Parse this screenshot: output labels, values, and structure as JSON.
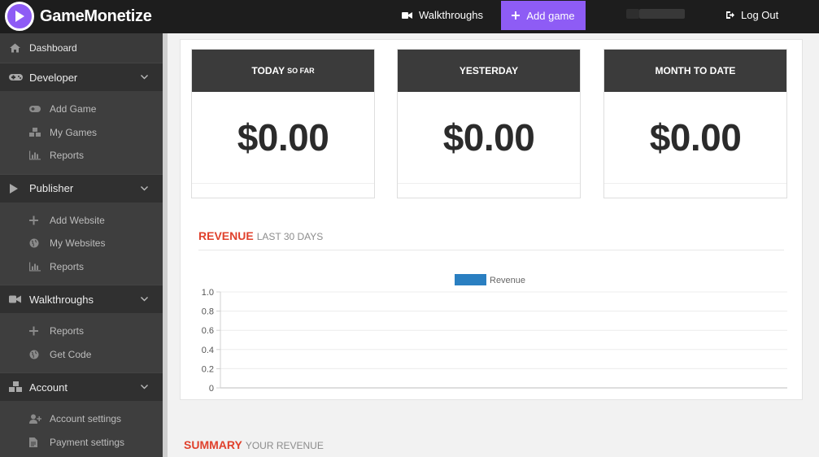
{
  "topbar": {
    "brand": "GameMonetize",
    "walkthroughs_label": "Walkthroughs",
    "add_game_label": "Add game",
    "logout_label": "Log Out"
  },
  "sidebar": {
    "dashboard": "Dashboard",
    "sections": [
      {
        "label": "Developer",
        "icon": "gamepad-icon",
        "items": [
          {
            "label": "Add Game",
            "icon": "gamepad-icon"
          },
          {
            "label": "My Games",
            "icon": "cubes-icon"
          },
          {
            "label": "Reports",
            "icon": "bar-chart-icon"
          }
        ]
      },
      {
        "label": "Publisher",
        "icon": "play-icon",
        "items": [
          {
            "label": "Add Website",
            "icon": "plus-icon"
          },
          {
            "label": "My Websites",
            "icon": "globe-icon"
          },
          {
            "label": "Reports",
            "icon": "bar-chart-icon"
          }
        ]
      },
      {
        "label": "Walkthroughs",
        "icon": "video-icon",
        "items": [
          {
            "label": "Reports",
            "icon": "plus-icon"
          },
          {
            "label": "Get Code",
            "icon": "globe-icon"
          }
        ]
      },
      {
        "label": "Account",
        "icon": "cubes-icon",
        "items": [
          {
            "label": "Account settings",
            "icon": "user-plus-icon"
          },
          {
            "label": "Payment settings",
            "icon": "document-icon"
          }
        ]
      }
    ]
  },
  "stats": [
    {
      "title": "TODAY",
      "title_suffix": "SO FAR",
      "value": "$0.00"
    },
    {
      "title": "YESTERDAY",
      "title_suffix": "",
      "value": "$0.00"
    },
    {
      "title": "MONTH TO DATE",
      "title_suffix": "",
      "value": "$0.00"
    }
  ],
  "revenue": {
    "title": "REVENUE",
    "subtitle": "LAST 30 DAYS"
  },
  "summary": {
    "title": "SUMMARY",
    "subtitle": "YOUR REVENUE"
  },
  "chart_data": {
    "type": "bar",
    "series": [
      {
        "name": "Revenue",
        "values": []
      }
    ],
    "categories": [],
    "ylim": [
      0,
      1
    ],
    "yticks": [
      "1.0",
      "0.8",
      "0.6",
      "0.4",
      "0.2",
      "0"
    ],
    "legend": "top-center",
    "grid": true,
    "series_color": "#2a7fc1"
  }
}
